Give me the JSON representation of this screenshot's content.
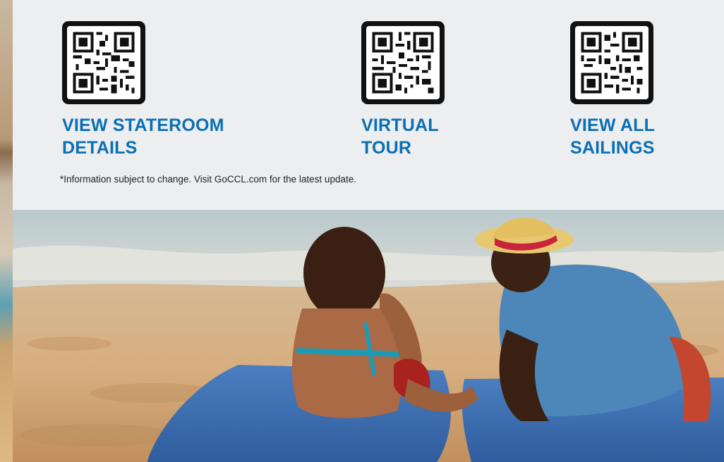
{
  "qr_codes": [
    {
      "icon": "qr-code-icon",
      "label_lines": [
        "VIEW STATEROOM",
        "DETAILS"
      ]
    },
    {
      "icon": "qr-code-icon",
      "label_lines": [
        "VIRTUAL",
        "TOUR"
      ]
    },
    {
      "icon": "qr-code-icon",
      "label_lines": [
        "VIEW ALL",
        "SAILINGS"
      ]
    }
  ],
  "disclaimer": "*Information subject to change. Visit GoCCL.com for the latest update.",
  "colors": {
    "link_blue": "#0b6fb4",
    "panel_bg": "#eceef0",
    "towel_blue": "#3f6eb0",
    "shirt_blue": "#4d86b8"
  },
  "photo": {
    "description_icon": "beach-couple-photo"
  }
}
